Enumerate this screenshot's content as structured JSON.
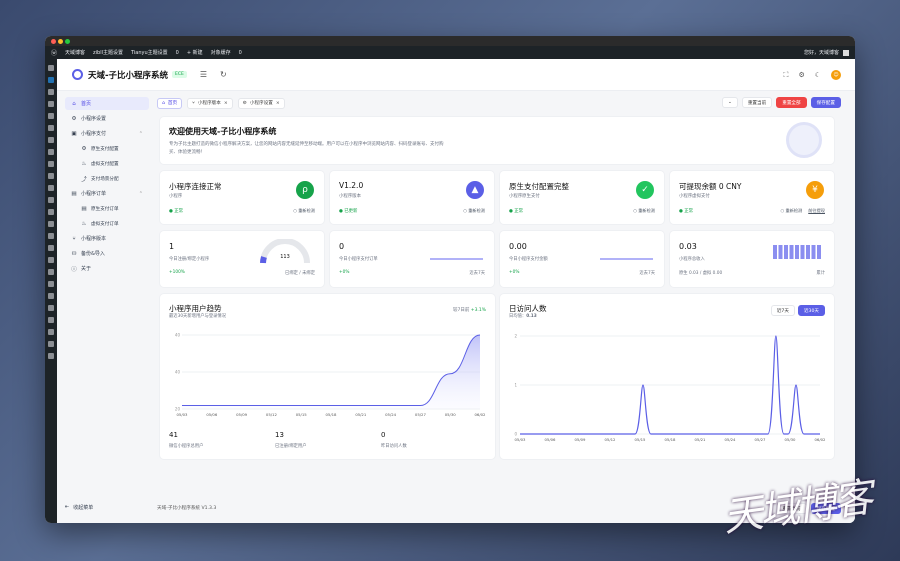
{
  "adminbar": {
    "items": [
      "天域博客",
      "zibll主题设置",
      "Tianyu主题设置",
      "0",
      "+ 新建",
      "对象缓存",
      "0"
    ],
    "greeting": "您好，天域博客"
  },
  "header": {
    "title": "天域-子比小程序系统",
    "version": "ECE"
  },
  "menu": {
    "items": [
      {
        "icon": "home-icon",
        "label": "首页",
        "active": true,
        "sub": false
      },
      {
        "icon": "settings-icon",
        "label": "小程序设置",
        "sub": false
      },
      {
        "icon": "wallet-icon",
        "label": "小程序支付",
        "sub": false,
        "expand": true
      },
      {
        "icon": "settings-icon",
        "label": "原生支付配置",
        "sub": true
      },
      {
        "icon": "flame-icon",
        "label": "虚拟支付配置",
        "sub": true
      },
      {
        "icon": "share-icon",
        "label": "支付场景分配",
        "sub": true
      },
      {
        "icon": "order-icon",
        "label": "小程序订单",
        "sub": false,
        "expand": true
      },
      {
        "icon": "order-icon",
        "label": "原生支付订单",
        "sub": true
      },
      {
        "icon": "flame-icon",
        "label": "虚拟支付订单",
        "sub": true
      },
      {
        "icon": "branch-icon",
        "label": "小程序版本",
        "sub": false
      },
      {
        "icon": "backup-icon",
        "label": "备份&导入",
        "sub": false
      },
      {
        "icon": "info-icon",
        "label": "关于",
        "sub": false
      }
    ],
    "collapse": "收起菜单"
  },
  "tabs": [
    {
      "label": "首页",
      "active": true
    },
    {
      "label": "小程序版本"
    },
    {
      "label": "小程序设置"
    }
  ],
  "actions": {
    "reset_current": "重置当前",
    "reset_all": "重置全部",
    "save": "保存配置"
  },
  "welcome": {
    "title": "欢迎使用天域-子比小程序系统",
    "desc": "专为子比主题打造的微信小程序解决方案，让您的网站内容无缝延伸至移动端。用户可以在小程序中浏览网站内容、扫码登录账号、支付购买、体验更流畅！"
  },
  "status": [
    {
      "title": "小程序连接正常",
      "sub": "小程序",
      "ok": "正常",
      "action": "重新检测",
      "color": "#16a34a",
      "glyph": "ρ"
    },
    {
      "title": "V1.2.0",
      "sub": "小程序版本",
      "ok": "已更新",
      "action": "重新检测",
      "color": "#5b5fe6",
      "glyph": "▲"
    },
    {
      "title": "原生支付配置完整",
      "sub": "小程序原生支付",
      "ok": "正常",
      "action": "重新检测",
      "color": "#22c55e",
      "glyph": "✓"
    },
    {
      "title": "可提现余额 0 CNY",
      "sub": "小程序虚拟支付",
      "ok": "正常",
      "action": "重新检测",
      "action2": "前往提现",
      "color": "#f59e0b",
      "glyph": "¥"
    }
  ],
  "metrics": [
    {
      "value": "1",
      "label": "今日注册/绑定小程序",
      "growth": "+100%",
      "right": "已绑定 / 未绑定",
      "gauge": 113
    },
    {
      "value": "0",
      "label": "今日小程序支付订单",
      "growth": "+0%",
      "right": "近去7天"
    },
    {
      "value": "0.00",
      "label": "今日小程序支付金额",
      "growth": "+0%",
      "right": "近去7天"
    },
    {
      "value": "0.03",
      "label": "小程序总收入",
      "growth": "原生 0.03 / 虚拟 0.00",
      "right": "累计"
    }
  ],
  "trend": {
    "title": "小程序用户趋势",
    "subtitle": "最近30天新增用户与登录情况",
    "compare": "较7日前",
    "growth": "+3.1%",
    "stats": [
      {
        "value": "41",
        "label": "微信小程序总用户"
      },
      {
        "value": "13",
        "label": "已注册/绑定用户"
      },
      {
        "value": "0",
        "label": "昨日访问人数"
      }
    ]
  },
  "visits": {
    "title": "日访问人数",
    "avg_label": "日均值：",
    "avg": "0.13",
    "btn7": "近7天",
    "btn30": "近30天"
  },
  "chart_data": [
    {
      "type": "area",
      "title": "小程序用户趋势",
      "x": [
        "05/03",
        "05/06",
        "05/09",
        "05/12",
        "05/15",
        "05/18",
        "05/21",
        "05/24",
        "05/27",
        "05/30",
        "06/02"
      ],
      "yticks": [
        "40",
        "40",
        "20"
      ],
      "y": [
        21,
        21,
        21,
        21,
        21,
        21,
        21,
        21,
        21,
        30,
        41
      ],
      "ylim": [
        20,
        41
      ]
    },
    {
      "type": "line",
      "title": "日访问人数",
      "x": [
        "05/03",
        "05/06",
        "05/09",
        "05/12",
        "05/15",
        "05/18",
        "05/21",
        "05/24",
        "05/27",
        "05/30",
        "06/02"
      ],
      "yticks": [
        "0",
        "1",
        "2"
      ],
      "ylim": [
        0,
        2
      ],
      "y": [
        0,
        0,
        0,
        0,
        1,
        0,
        0,
        0,
        0,
        2,
        1,
        0
      ]
    }
  ],
  "footer": {
    "text": "天域-子比小程序系统 V1.3.3",
    "reset": "重置当前",
    "save": "保存配置"
  },
  "watermark": "天域博客"
}
